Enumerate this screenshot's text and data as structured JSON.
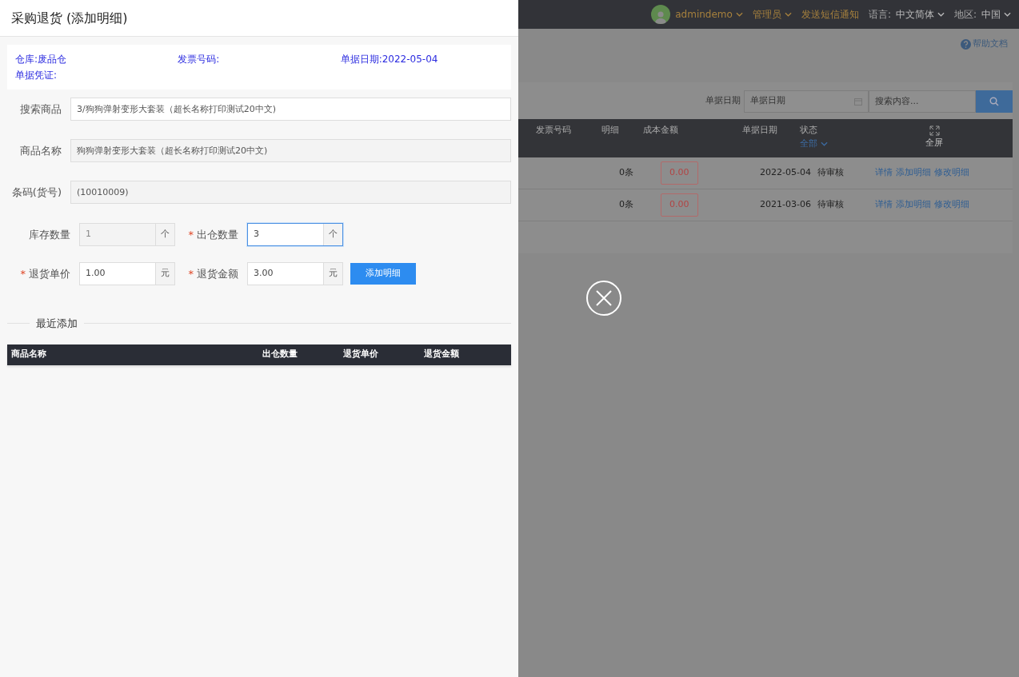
{
  "drawer": {
    "title": "采购退货 (添加明细)",
    "info": [
      {
        "label": "仓库:",
        "value": "废品仓"
      },
      {
        "label": "发票号码:"
      },
      {
        "label": "单据日期:",
        "value": "2022-05-04"
      },
      {
        "label": "单据凭证:"
      }
    ],
    "fields": [
      {
        "label": "搜索商品",
        "value": "3/狗狗弹射变形大套装（超长名称打印测试20中文)",
        "readonly": false
      },
      {
        "label": "商品名称",
        "value": "狗狗弹射变形大套装（超长名称打印测试20中文)",
        "readonly": true
      },
      {
        "label": "条码(货号)",
        "value": "(10010009)",
        "readonly": true
      }
    ],
    "pair_rows": [
      [
        {
          "label": "库存数量",
          "value": "1",
          "unit": "个",
          "readonly": true,
          "focused": false
        },
        {
          "label": "出仓数量",
          "required_mark": "*",
          "value": "3",
          "unit": "个",
          "readonly": false,
          "focused": true
        }
      ],
      [
        {
          "label": "退货单价",
          "required_mark": "*",
          "value": "1.00",
          "unit": "元",
          "readonly": false,
          "focused": false
        },
        {
          "label": "退货金额",
          "required_mark": "*",
          "value": "3.00",
          "unit": "元",
          "readonly": false,
          "focused": false
        }
      ]
    ],
    "add_button": "添加明细",
    "recent_title": "最近添加",
    "recent_columns": [
      "商品名称",
      "出仓数量",
      "退货单价",
      "退货金额"
    ]
  },
  "background": {
    "user": "admindemo",
    "role": "管理员",
    "sms": "发送短信通知",
    "language_label": "语言:",
    "language": "中文简体",
    "region_label": "地区:",
    "region": "中国",
    "help": "帮助文档",
    "date_filter_label": "单据日期",
    "date_placeholder": "单据日期",
    "search_placeholder": "搜索内容...",
    "columns": [
      "发票号码",
      "明细",
      "成本金额",
      "单据日期",
      "状态"
    ],
    "status_filter": "全部",
    "fullscreen": "全屏",
    "rows": [
      {
        "detail": "0条",
        "cost": "0.00",
        "date": "2022-05-04",
        "status": "待审核",
        "actions": [
          "详情",
          "添加明细",
          "修改明细"
        ]
      },
      {
        "detail": "0条",
        "cost": "0.00",
        "date": "2021-03-06",
        "status": "待审核",
        "actions": [
          "详情",
          "添加明细",
          "修改明细"
        ]
      }
    ]
  }
}
